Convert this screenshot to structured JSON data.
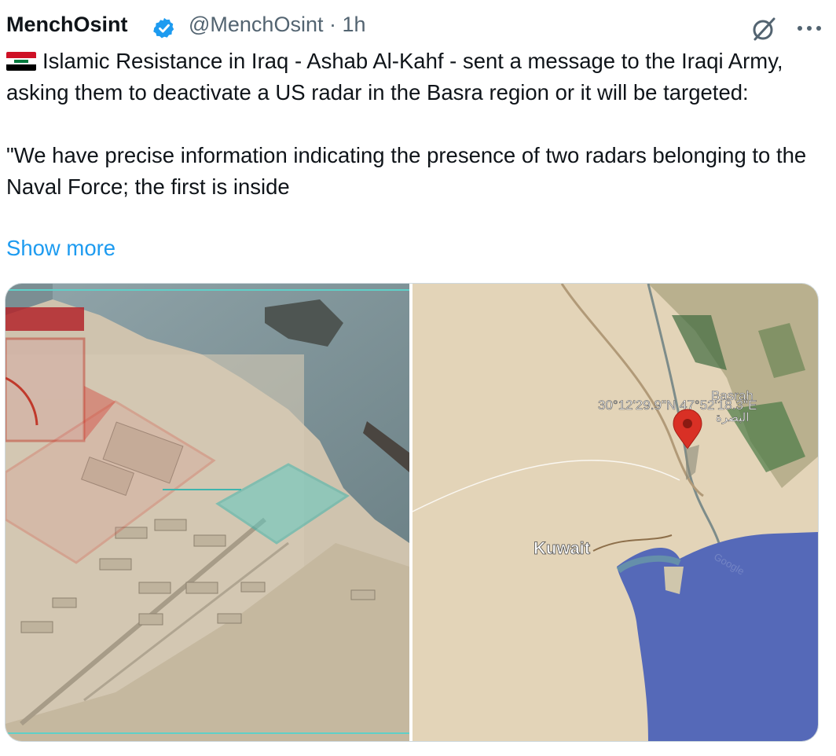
{
  "post": {
    "author": {
      "display_name": "MenchOsint",
      "handle": "@MenchOsint",
      "separator": " · ",
      "time": "1h",
      "verified": true,
      "verified_color": "#1d9bf0"
    },
    "icons": {
      "verified": "verified-badge-icon",
      "grok": "grok-icon",
      "more": "more-horizontal-icon",
      "flag": "iraq-flag-emoji"
    },
    "text": {
      "line1": "Islamic Resistance in Iraq - Ashab Al-Kahf - sent a message to the Iraqi Army, asking them to deactivate a US radar in the Basra region or it will be targeted:",
      "line2": "\"We have precise information indicating the presence of two radars belonging to the Naval Force; the first is inside"
    },
    "show_more": "Show more",
    "colors": {
      "link": "#1d9bf0",
      "text": "#0f1419",
      "secondary": "#536471"
    }
  },
  "media": {
    "map": {
      "coordinates": "30°12'29.9\"N 47°52'18.3\"E",
      "city_latin": "Basrah",
      "city_arabic": "البصرة",
      "country_label": "Kuwait",
      "watermark": "Google",
      "pin_color": "#d93025"
    }
  }
}
